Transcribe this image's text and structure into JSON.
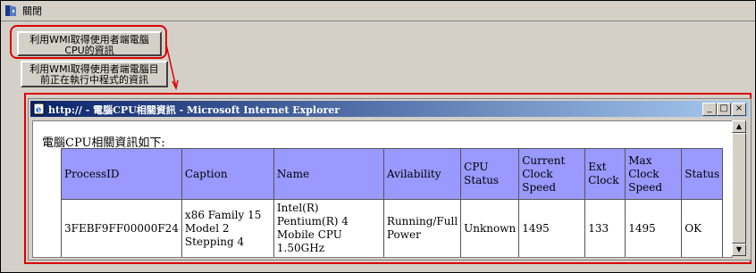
{
  "menubar": {
    "close_label": "關閉"
  },
  "buttons": {
    "cpu_info_label": "利用WMI取得使用者端電腦CPU的資訊",
    "process_label": "利用WMI取得使用者端電腦目前正在執行中程式的資訊"
  },
  "browser": {
    "title": "http:// - 電腦CPU相關資訊 - Microsoft Internet Explorer",
    "minimize": "_",
    "maximize": "□",
    "close": "×"
  },
  "page": {
    "heading": "電腦CPU相關資訊如下:",
    "table": {
      "headers": [
        "ProcessID",
        "Caption",
        "Name",
        "Avilability",
        "CPU Status",
        "Current Clock Speed",
        "Ext Clock",
        "Max Clock Speed",
        "Status"
      ],
      "rows": [
        [
          "3FEBF9FF00000F24",
          "x86 Family 15 Model 2 Stepping 4",
          "Intel(R) Pentium(R) 4 Mobile CPU 1.50GHz",
          "Running/Full Power",
          "Unknown",
          "1495",
          "133",
          "1495",
          "OK"
        ]
      ]
    }
  },
  "colors": {
    "highlight": "#dd0000",
    "header_bg": "#9999ff",
    "titlebar_start": "#0a246a",
    "titlebar_end": "#a6caf0"
  }
}
